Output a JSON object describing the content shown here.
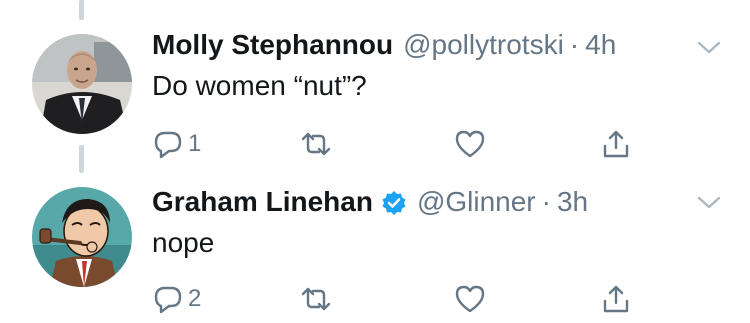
{
  "tweets": [
    {
      "display_name": "Molly Stephannou",
      "handle": "@pollytrotski",
      "separator": "·",
      "time": "4h",
      "verified": false,
      "text": "Do women “nut”?",
      "reply_count": "1",
      "avatar": "suited-man-avatar"
    },
    {
      "display_name": "Graham Linehan",
      "handle": "@Glinner",
      "separator": "·",
      "time": "3h",
      "verified": true,
      "text": "nope",
      "reply_count": "2",
      "avatar": "cartoon-pipe-smoker-avatar"
    }
  ],
  "icons": {
    "reply": "reply-icon",
    "retweet": "retweet-icon",
    "like": "heart-icon",
    "share": "share-icon",
    "menu": "chevron-down-icon",
    "verified": "verified-badge-icon"
  },
  "colors": {
    "text": "#14171a",
    "secondary": "#657786",
    "verified_blue": "#1da1f2",
    "thread_line": "#ccd6dd"
  }
}
